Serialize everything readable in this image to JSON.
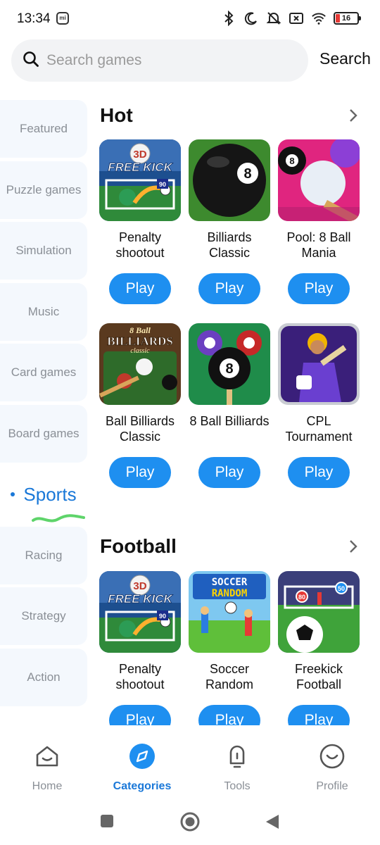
{
  "status": {
    "time": "13:34",
    "mi_badge": "mi",
    "battery": "16",
    "icons": [
      "bluetooth-icon",
      "moon-icon",
      "bell-muted-icon",
      "sim-x-icon",
      "wifi-icon"
    ]
  },
  "search": {
    "placeholder": "Search games",
    "button_label": "Search"
  },
  "sidebar": {
    "items": [
      {
        "label": "Featured"
      },
      {
        "label": "Puzzle games"
      },
      {
        "label": "Simulation"
      },
      {
        "label": "Music"
      },
      {
        "label": "Card games"
      },
      {
        "label": "Board games"
      },
      {
        "label": "Sports",
        "active": true
      },
      {
        "label": "Racing"
      },
      {
        "label": "Strategy"
      },
      {
        "label": "Action"
      }
    ]
  },
  "sections": [
    {
      "title": "Hot",
      "games": [
        {
          "name": "Penalty shootout",
          "play": "Play"
        },
        {
          "name": "Billiards Classic",
          "play": "Play"
        },
        {
          "name": "Pool: 8 Ball Mania",
          "play": "Play"
        },
        {
          "name": "Ball Billiards Classic",
          "play": "Play"
        },
        {
          "name": "8 Ball Billiards",
          "play": "Play"
        },
        {
          "name": "CPL Tournament",
          "play": "Play"
        }
      ]
    },
    {
      "title": "Football",
      "games": [
        {
          "name": "Penalty shootout",
          "play": "Play"
        },
        {
          "name": "Soccer Random",
          "play": "Play"
        },
        {
          "name": "Freekick Football",
          "play": "Play"
        }
      ]
    }
  ],
  "thumb_text": {
    "freekick_top": "3D",
    "freekick_bottom": "FREE KICK",
    "billiards_title": "BILLIARDS",
    "billiards_sub": "classic",
    "billiards_8ball": "8 Ball",
    "soccer_random_1": "SOCCER",
    "soccer_random_2": "RANDOM",
    "jersey_number": "90",
    "target_50": "50",
    "target_80": "80"
  },
  "bottom_nav": [
    {
      "label": "Home",
      "icon": "home-icon"
    },
    {
      "label": "Categories",
      "icon": "compass-icon",
      "active": true
    },
    {
      "label": "Tools",
      "icon": "tools-icon"
    },
    {
      "label": "Profile",
      "icon": "profile-icon"
    }
  ],
  "colors": {
    "accent": "#1e8ff0",
    "active_text": "#1a78d8",
    "sidebar_bg": "#f4f8fd"
  }
}
